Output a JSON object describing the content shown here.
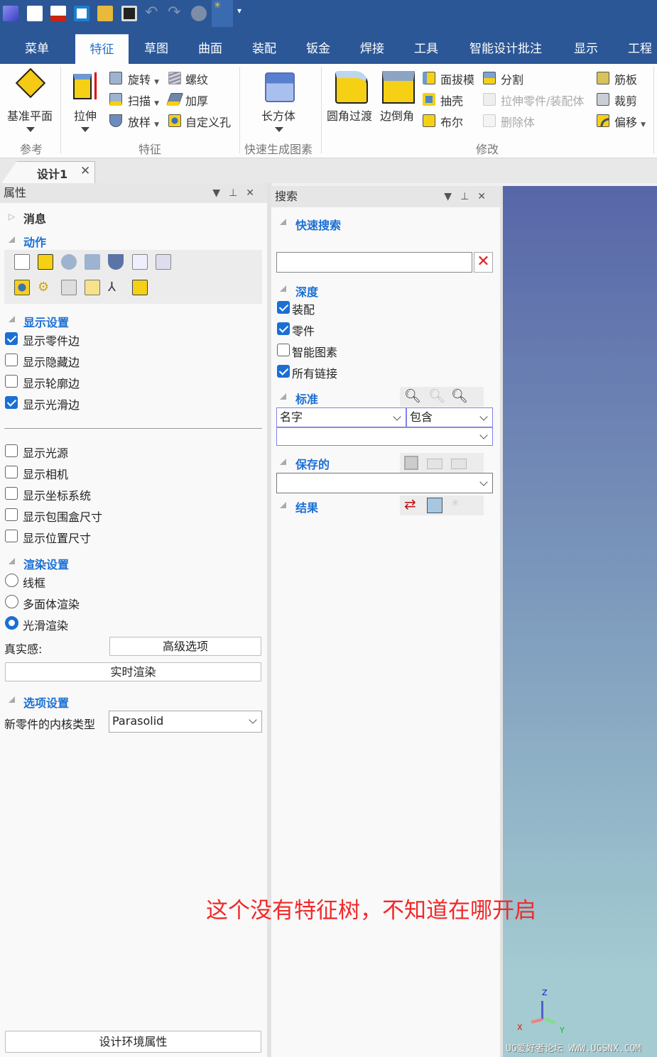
{
  "quick_access": [
    "app-logo-icon",
    "new-icon",
    "open-mail-icon",
    "preview-icon",
    "open-folder-icon",
    "save-icon",
    "undo-icon",
    "redo-icon",
    "sphere-icon",
    "tree-icon",
    "more-icon"
  ],
  "tabs": [
    "菜单",
    "特征",
    "草图",
    "曲面",
    "装配",
    "钣金",
    "焊接",
    "工具",
    "智能设计批注",
    "显示",
    "工程标"
  ],
  "ribbon": {
    "datum_plane": "基准平面",
    "ref_group": "参考",
    "extrude": "拉伸",
    "revolve": "旋转",
    "sweep": "扫描",
    "loft": "放样",
    "thread": "螺纹",
    "thicken": "加厚",
    "custom_hole": "自定义孔",
    "feature_group": "特征",
    "box": "长方体",
    "quick_group": "快速生成图素",
    "fillet": "圆角过渡",
    "chamfer": "边倒角",
    "face_draft": "面拔模",
    "shell": "抽壳",
    "boolean": "布尔",
    "split": "分割",
    "stretch": "拉伸零件/装配体",
    "delete_body": "删除体",
    "rib": "筋板",
    "trim": "裁剪",
    "offset": "偏移",
    "modify_group": "修改"
  },
  "doc_tab": "设计1",
  "properties": {
    "title": "属性",
    "messages": "消息",
    "actions": "动作",
    "display_settings": "显示设置",
    "display_checks": [
      {
        "label": "显示零件边",
        "checked": true
      },
      {
        "label": "显示隐藏边",
        "checked": false
      },
      {
        "label": "显示轮廓边",
        "checked": false
      },
      {
        "label": "显示光滑边",
        "checked": true
      }
    ],
    "display_checks2": [
      {
        "label": "显示光源",
        "checked": false
      },
      {
        "label": "显示相机",
        "checked": false
      },
      {
        "label": "显示坐标系统",
        "checked": false
      },
      {
        "label": "显示包围盒尺寸",
        "checked": false
      },
      {
        "label": "显示位置尺寸",
        "checked": false
      }
    ],
    "render_settings": "渲染设置",
    "render_modes": [
      {
        "label": "线框",
        "selected": false
      },
      {
        "label": "多面体渲染",
        "selected": false
      },
      {
        "label": "光滑渲染",
        "selected": true
      }
    ],
    "realism_label": "真实感:",
    "advanced_button": "高级选项",
    "realtime_button": "实时渲染",
    "option_settings": "选项设置",
    "kernel_label": "新零件的内核类型",
    "kernel_value": "Parasolid",
    "env_button": "设计环境属性"
  },
  "search": {
    "title": "搜索",
    "quick_search": "快速搜索",
    "query": "",
    "depth": "深度",
    "depth_checks": [
      {
        "label": "装配",
        "checked": true
      },
      {
        "label": "零件",
        "checked": true
      },
      {
        "label": "智能图素",
        "checked": false
      },
      {
        "label": "所有链接",
        "checked": true
      }
    ],
    "criteria": "标准",
    "field": "名字",
    "operator": "包含",
    "value": "",
    "saved": "保存的",
    "saved_value": "",
    "results": "结果"
  },
  "annotation": "这个没有特征树，不知道在哪开启",
  "axes": {
    "x": "X",
    "y": "Y",
    "z": "Z"
  },
  "watermark": "UG爱好者论坛 WWW.UGSNX.COM"
}
